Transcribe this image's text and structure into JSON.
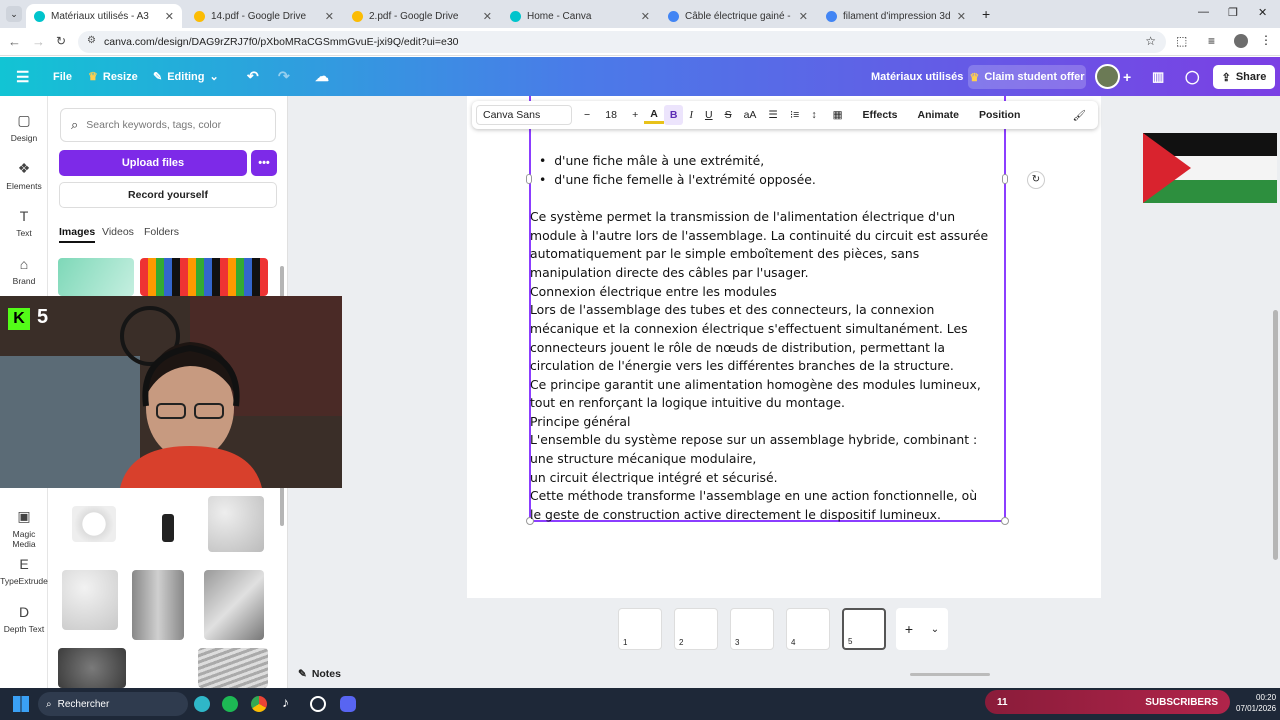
{
  "browser": {
    "tabs": [
      {
        "title": "Matériaux utilisés - A3",
        "active": true,
        "color": "#00c4cc"
      },
      {
        "title": "14.pdf - Google Drive",
        "active": false,
        "color": "#fbbc04"
      },
      {
        "title": "2.pdf - Google Drive",
        "active": false,
        "color": "#fbbc04"
      },
      {
        "title": "Home - Canva",
        "active": false,
        "color": "#00c4cc"
      },
      {
        "title": "Câble électrique gainé - Google",
        "active": false,
        "color": "#4285f4"
      },
      {
        "title": "filament d'impression 3d - Goo",
        "active": false,
        "color": "#4285f4"
      }
    ],
    "url": "canva.com/design/DAG9rZRJ7f0/pXboMRaCGSmmGvuE-jxi9Q/edit?ui=e30"
  },
  "topbar": {
    "file": "File",
    "resize": "Resize",
    "editing": "Editing",
    "doc_title": "Matériaux utilisés",
    "claim": "Claim student offer",
    "share": "Share"
  },
  "rail": [
    {
      "label": "Design",
      "icon": "design-icon"
    },
    {
      "label": "Elements",
      "icon": "elements-icon"
    },
    {
      "label": "Text",
      "icon": "text-icon"
    },
    {
      "label": "Brand",
      "icon": "brand-icon"
    },
    {
      "label": "Magic Media",
      "icon": "magic-media-icon"
    },
    {
      "label": "TypeExtrude",
      "icon": "typeextrude-icon"
    },
    {
      "label": "Depth Text",
      "icon": "depth-text-icon"
    }
  ],
  "panel": {
    "search_placeholder": "Search keywords, tags, color",
    "upload": "Upload files",
    "record": "Record yourself",
    "tabs": [
      "Images",
      "Videos",
      "Folders"
    ]
  },
  "toolbar": {
    "font": "Canva Sans",
    "size": "18",
    "effects": "Effects",
    "animate": "Animate",
    "position": "Position"
  },
  "document": {
    "bullets": [
      "d'une fiche mâle à une extrémité,",
      "d'une fiche femelle à l'extrémité opposée."
    ],
    "lines": [
      "Ce système permet la transmission de l'alimentation électrique d'un",
      "module à l'autre lors de l'assemblage. La continuité du circuit est assurée",
      "automatiquement par le simple emboîtement des pièces, sans",
      "manipulation directe des câbles par l'usager.",
      "Connexion électrique entre les modules",
      "Lors de l'assemblage des tubes et des connecteurs, la connexion",
      "mécanique et la connexion électrique s'effectuent simultanément. Les",
      "connecteurs jouent le rôle de nœuds de distribution, permettant la",
      "circulation de l'énergie vers les différentes branches de la structure.",
      " Ce principe garantit une alimentation homogène des modules lumineux,",
      "tout en renforçant la logique intuitive du montage.",
      "Principe général",
      "L'ensemble du système repose sur un assemblage hybride, combinant :",
      "une structure mécanique modulaire,",
      "un circuit électrique intégré et sécurisé.",
      "Cette méthode transforme l'assemblage en une action fonctionnelle, où",
      "le geste de construction active directement le dispositif lumineux."
    ]
  },
  "pages": [
    "1",
    "2",
    "3",
    "4",
    "5"
  ],
  "notes": "Notes",
  "webcam": {
    "badge": "5"
  },
  "taskbar": {
    "search": "Rechercher",
    "subscribers": "SUBSCRIBERS",
    "sub_count": "11",
    "time": "00:20",
    "date": "07/01/2026"
  },
  "colors": {
    "accent": "#7d2ae8",
    "selection": "#8b3dff"
  }
}
